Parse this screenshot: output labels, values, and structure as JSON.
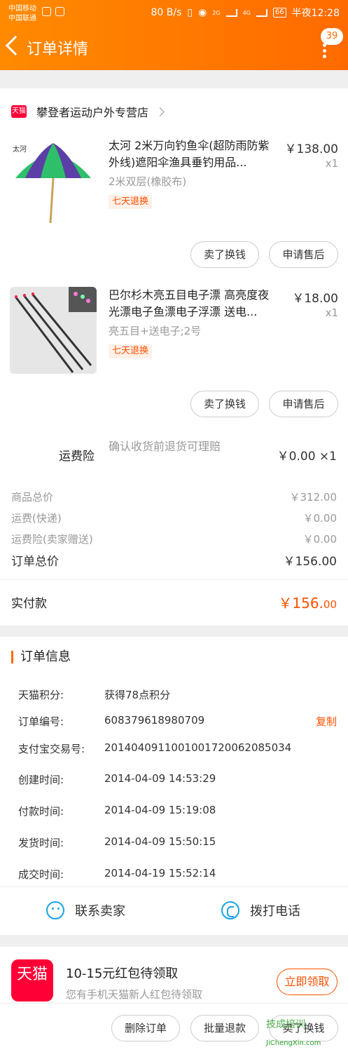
{
  "status_bar": {
    "carrier1": "中国移动",
    "carrier2": "中国联通",
    "speed": "80 B/s",
    "network1": "2G",
    "network2": "4G",
    "battery": "66",
    "time": "半夜12:28"
  },
  "header": {
    "title": "订单详情",
    "message_count": "39"
  },
  "shop": {
    "tmall_badge": "天猫",
    "name": "攀登者运动户外专营店"
  },
  "items": [
    {
      "title": "太河 2米万向钓鱼伞(超防雨防紫外线)遮阳伞渔具垂钓用品...",
      "price": "￥138.00",
      "qty": "x1",
      "spec": "2米双层(橡胶布)",
      "tag": "七天退换",
      "btn_exchange": "卖了换钱",
      "btn_aftersale": "申请售后"
    },
    {
      "title": "巴尔杉木亮五目电子漂 高亮度夜光漂电子鱼漂电子浮漂 送电...",
      "price": "￥18.00",
      "qty": "x1",
      "spec": "亮五目+送电子;2号",
      "tag": "七天退换",
      "btn_exchange": "卖了换钱",
      "btn_aftersale": "申请售后"
    }
  ],
  "insurance": {
    "label": "运费险",
    "desc": "确认收货前退货可理赔",
    "price": "￥0.00 ×1"
  },
  "summary": {
    "goods_total_label": "商品总价",
    "goods_total": "￥312.00",
    "shipping_label": "运费(快递)",
    "shipping": "￥0.00",
    "insurance_label": "运费险(卖家赠送)",
    "insurance": "￥0.00",
    "order_total_label": "订单总价",
    "order_total": "￥156.00",
    "paid_label": "实付款",
    "paid_main": "￥156.",
    "paid_decimal": "00"
  },
  "order_info": {
    "title": "订单信息",
    "rows": [
      {
        "label": "天猫积分:",
        "value": "获得78点积分"
      },
      {
        "label": "订单编号:",
        "value": "608379618980709"
      },
      {
        "label": "支付宝交易号:",
        "value": "2014040911001001720062085034"
      },
      {
        "label": "创建时间:",
        "value": "2014-04-09 14:53:29"
      },
      {
        "label": "付款时间:",
        "value": "2014-04-09 15:19:08"
      },
      {
        "label": "发货时间:",
        "value": "2014-04-09 15:50:15"
      },
      {
        "label": "成交时间:",
        "value": "2014-04-19 15:52:14"
      }
    ],
    "copy": "复制",
    "contact_seller": "联系卖家",
    "call": "拨打电话"
  },
  "promo": {
    "logo_text": "天猫",
    "title": "10-15元红包待领取",
    "subtitle": "您有手机天猫新人红包待领取",
    "button": "立即领取"
  },
  "bottom_bar": {
    "delete": "删除订单",
    "batch_refund": "批量退款",
    "sell": "卖了换钱"
  },
  "watermark": {
    "text": "技成培训",
    "url": "JiChengXin.com"
  },
  "colors": {
    "accent": "#ff6a00",
    "price_red": "#ff5000",
    "tmall_red": "#ff0036",
    "link_blue": "#1aa3e8"
  }
}
